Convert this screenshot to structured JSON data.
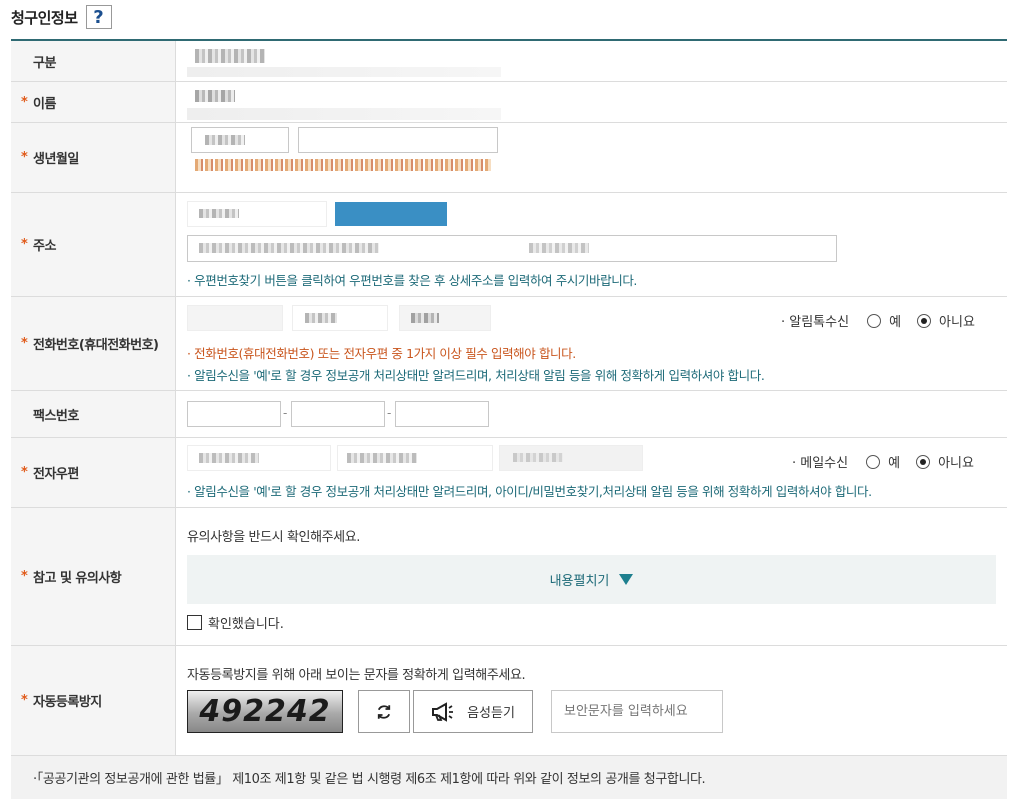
{
  "title": "청구인정보",
  "help_label": "?",
  "rows": {
    "category": "구분",
    "name": "이름",
    "birth": "생년월일",
    "address": "주소",
    "address_note": "· 우편번호찾기 버튼을 클릭하여 우편번호를 찾은 후 상세주소를 입력하여 주시기바랍니다.",
    "phone": "전화번호(휴대전화번호)",
    "phone_note1": "· 전화번호(휴대전화번호) 또는 전자우편 중 1가지 이상 필수 입력해야 합니다.",
    "phone_note2": "· 알림수신을 '예'로 할 경우 정보공개 처리상태만 알려드리며, 처리상태 알림 등을 위해 정확하게 입력하셔야 합니다.",
    "kakao_label": "· 알림톡수신",
    "fax": "팩스번호",
    "email": "전자우편",
    "email_note": "· 알림수신을 '예'로 할 경우 정보공개 처리상태만 알려드리며, 아이디/비밀번호찾기,처리상태 알림 등을 위해 정확하게 입력하셔야 합니다.",
    "mail_label": "· 메일수신",
    "notice": "참고 및 유의사항",
    "notice_text": "유의사항을 반드시 확인해주세요.",
    "expand": "내용펼치기",
    "confirm": "확인했습니다.",
    "captcha": "자동등록방지",
    "captcha_text": "자동등록방지를 위해 아래 보이는 문자를 정확하게 입력해주세요.",
    "captcha_code": "492242",
    "audio": "음성듣기",
    "captcha_placeholder": "보안문자를 입력하세요"
  },
  "options": {
    "yes": "예",
    "no": "아니요"
  },
  "dash": "-",
  "footer": "·「공공기관의 정보공개에 관한 법률」 제10조 제1항 및 같은 법 시행령 제6조 제1항에 따라 위와 같이 정보의 공개를 청구합니다."
}
